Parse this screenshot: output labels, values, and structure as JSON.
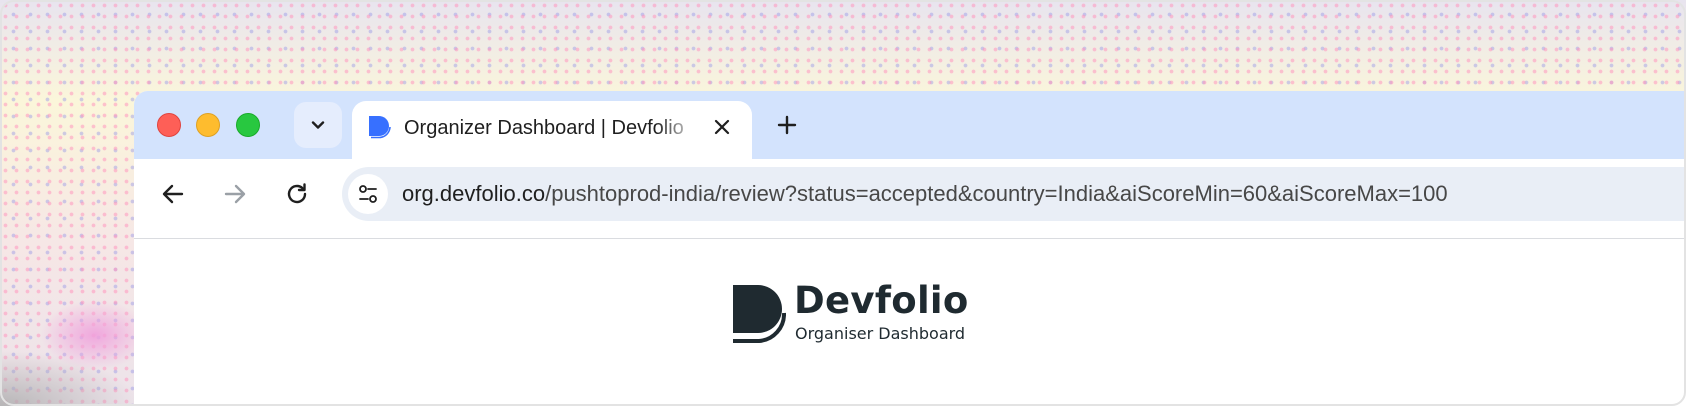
{
  "browser": {
    "window_controls": {
      "close": "close",
      "minimize": "minimize",
      "zoom": "zoom"
    },
    "tab_search_icon": "chevron-down-icon",
    "tab": {
      "title": "Organizer Dashboard | Devfolio",
      "favicon": "devfolio-d-logo",
      "favicon_color": "#3770ff",
      "close_icon": "close-icon"
    },
    "new_tab_icon": "plus-icon",
    "nav": {
      "back_icon": "arrow-left-icon",
      "forward_icon": "arrow-right-icon",
      "reload_icon": "reload-icon"
    },
    "address_bar": {
      "site_info_icon": "tune-icon",
      "host": "org.devfolio.co",
      "path": "/pushtoprod-india/review?status=accepted&country=India&aiScoreMin=60&aiScoreMax=100"
    },
    "colors": {
      "tabstrip": "#d3e3fd",
      "omnibox": "#e9eef6",
      "text": "#1f1f1f"
    }
  },
  "page": {
    "brand": {
      "name": "Devfolio",
      "subtitle": "Organiser Dashboard",
      "color": "#1f2a30"
    }
  }
}
